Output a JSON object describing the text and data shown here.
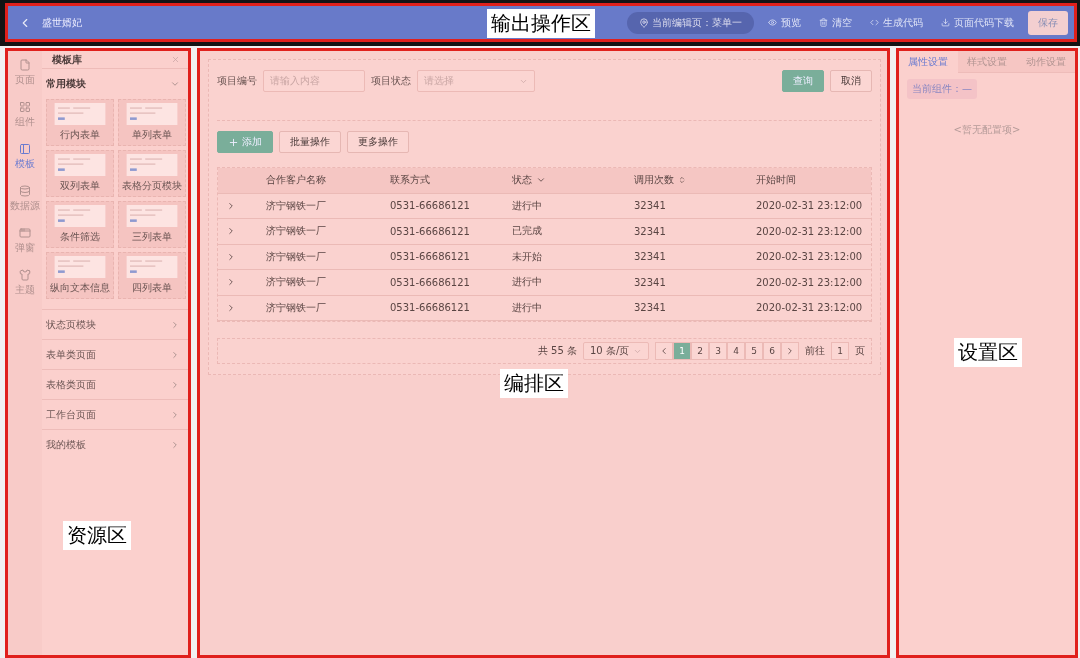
{
  "topbar": {
    "title": "盛世婿妃",
    "current_page": "当前编辑页：菜单一",
    "actions": [
      {
        "label": "预览"
      },
      {
        "label": "清空"
      },
      {
        "label": "生成代码"
      },
      {
        "label": "页面代码下载"
      }
    ],
    "save": "保存",
    "annotation": "输出操作区"
  },
  "sidebar": {
    "nav": [
      {
        "label": "页面",
        "selected": false
      },
      {
        "label": "组件",
        "selected": false
      },
      {
        "label": "模板",
        "selected": true
      },
      {
        "label": "数据源",
        "selected": false
      },
      {
        "label": "弹窗",
        "selected": false
      },
      {
        "label": "主题",
        "selected": false
      }
    ],
    "panel_title": "模板库",
    "section": {
      "title": "常用模块",
      "expanded": true,
      "templates": [
        "行内表单",
        "单列表单",
        "双列表单",
        "表格分页模块",
        "条件筛选",
        "三列表单",
        "纵向文本信息",
        "四列表单"
      ]
    },
    "groups": [
      "状态页模块",
      "表单类页面",
      "表格类页面",
      "工作台页面",
      "我的模板"
    ],
    "annotation": "资源区"
  },
  "canvas": {
    "filters": [
      {
        "label": "项目编号",
        "placeholder": "请输入内容",
        "kind": "input"
      },
      {
        "label": "项目状态",
        "placeholder": "请选择",
        "kind": "select"
      }
    ],
    "query": "查询",
    "cancel": "取消",
    "add": "添加",
    "batch": "批量操作",
    "more": "更多操作",
    "table": {
      "columns": [
        {
          "label": "合作客户名称",
          "kind": "plain"
        },
        {
          "label": "联系方式",
          "kind": "plain"
        },
        {
          "label": "状态",
          "kind": "filter"
        },
        {
          "label": "调用次数",
          "kind": "sort"
        },
        {
          "label": "开始时间",
          "kind": "plain"
        }
      ],
      "rows": [
        [
          "济宁钢铁一厂",
          "0531-66686121",
          "进行中",
          "32341",
          "2020-02-31 23:12:00"
        ],
        [
          "济宁钢铁一厂",
          "0531-66686121",
          "已完成",
          "32341",
          "2020-02-31 23:12:00"
        ],
        [
          "济宁钢铁一厂",
          "0531-66686121",
          "未开始",
          "32341",
          "2020-02-31 23:12:00"
        ],
        [
          "济宁钢铁一厂",
          "0531-66686121",
          "进行中",
          "32341",
          "2020-02-31 23:12:00"
        ],
        [
          "济宁钢铁一厂",
          "0531-66686121",
          "进行中",
          "32341",
          "2020-02-31 23:12:00"
        ]
      ]
    },
    "pagination": {
      "total": "共 55 条",
      "page_size": "10 条/页",
      "pages": [
        {
          "label": "1",
          "selected": true
        },
        {
          "label": "2",
          "selected": false
        },
        {
          "label": "3",
          "selected": false
        },
        {
          "label": "4",
          "selected": false
        },
        {
          "label": "5",
          "selected": false
        },
        {
          "label": "6",
          "selected": false
        }
      ],
      "goto": "前往",
      "goto_value": "1",
      "goto_suffix": "页"
    },
    "annotation": "编排区"
  },
  "settings": {
    "tabs": [
      {
        "label": "属性设置",
        "selected": true
      },
      {
        "label": "样式设置",
        "selected": false
      },
      {
        "label": "动作设置",
        "selected": false
      }
    ],
    "current_component": "当前组件：—",
    "empty": "<暂无配置项>",
    "annotation": "设置区"
  }
}
